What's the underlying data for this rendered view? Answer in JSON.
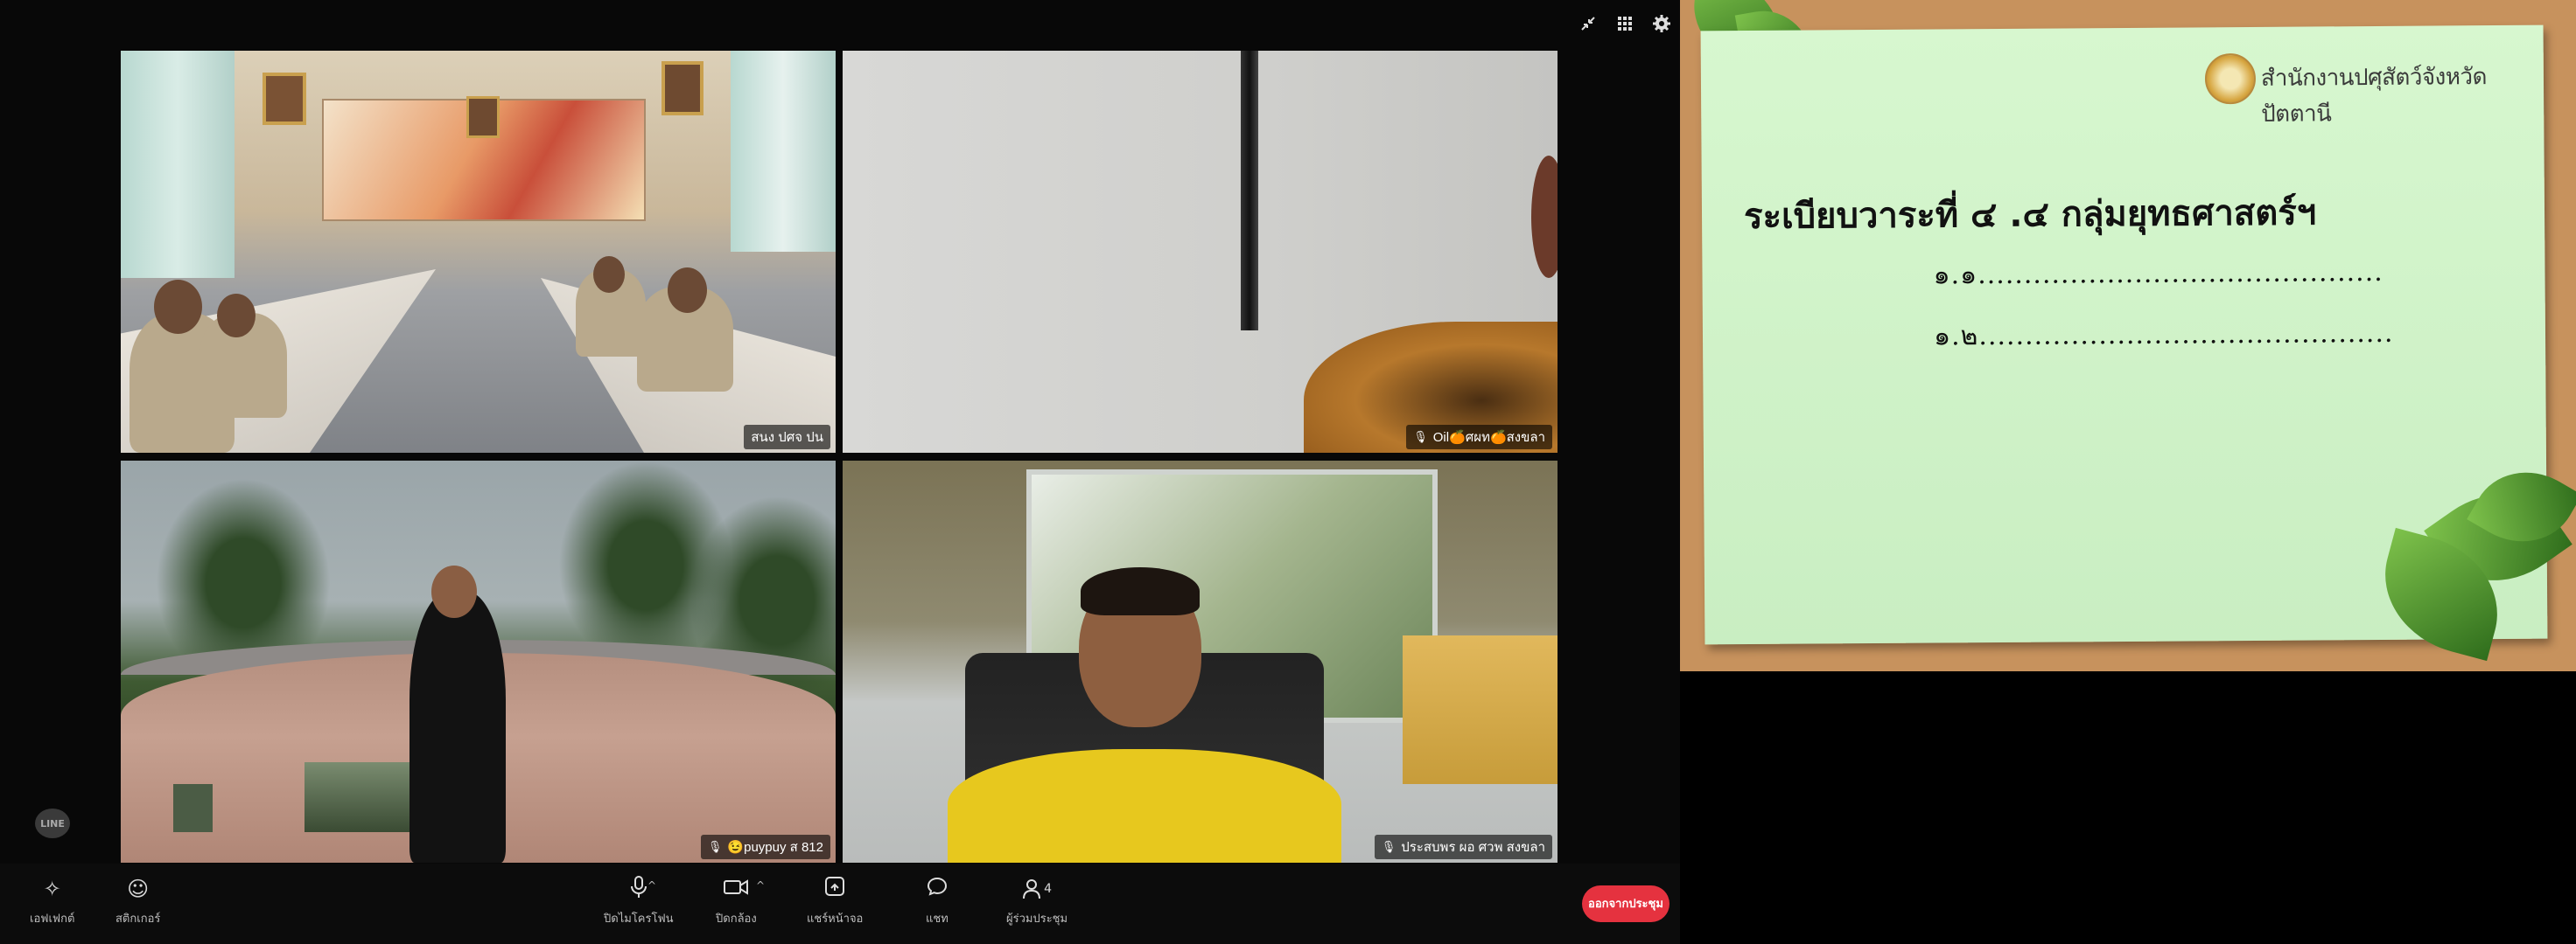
{
  "meeting": {
    "top_icons": [
      "minimize-icon",
      "grid-layout-icon",
      "settings-gear-icon"
    ],
    "tiles": [
      {
        "name": "สนง ปศจ ปน",
        "muted": false
      },
      {
        "name": "Oil🍊ศผท🍊สงขลา",
        "muted": true
      },
      {
        "name": "😉puypuy ส 812",
        "muted": true
      },
      {
        "name": "ประสบพร ผอ ศวพ สงขลา",
        "muted": true
      }
    ],
    "watermark": "LINE"
  },
  "toolbar": {
    "effects": {
      "icon": "sparkle-icon",
      "label": "เอฟเฟกต์"
    },
    "stickers": {
      "icon": "smiley-icon",
      "label": "สติกเกอร์"
    },
    "mic": {
      "icon": "microphone-icon",
      "label": "ปิดไมโครโฟน",
      "caret": "^"
    },
    "camera": {
      "icon": "camera-icon",
      "label": "ปิดกล้อง",
      "caret": "^"
    },
    "share": {
      "icon": "share-screen-icon",
      "label": "แชร์หน้าจอ"
    },
    "chat": {
      "icon": "chat-bubble-icon",
      "label": "แชท"
    },
    "participants": {
      "icon": "person-icon",
      "label": "ผู้ร่วมประชุม",
      "count": "4"
    },
    "leave_label": "ออกจากประชุม",
    "leave_color": "#e5323f"
  },
  "slide": {
    "org": "สำนักงานปศุสัตว์จังหวัดปัตตานี",
    "title": "ระเบียบวาระที่ ๔ .๔ กลุ่มยุทธศาสตร์ฯ",
    "lines": [
      "๑.๑............................................",
      "๑.๒............................................."
    ],
    "paper_color": "#d3f4cc",
    "board_color": "#c7925d"
  }
}
